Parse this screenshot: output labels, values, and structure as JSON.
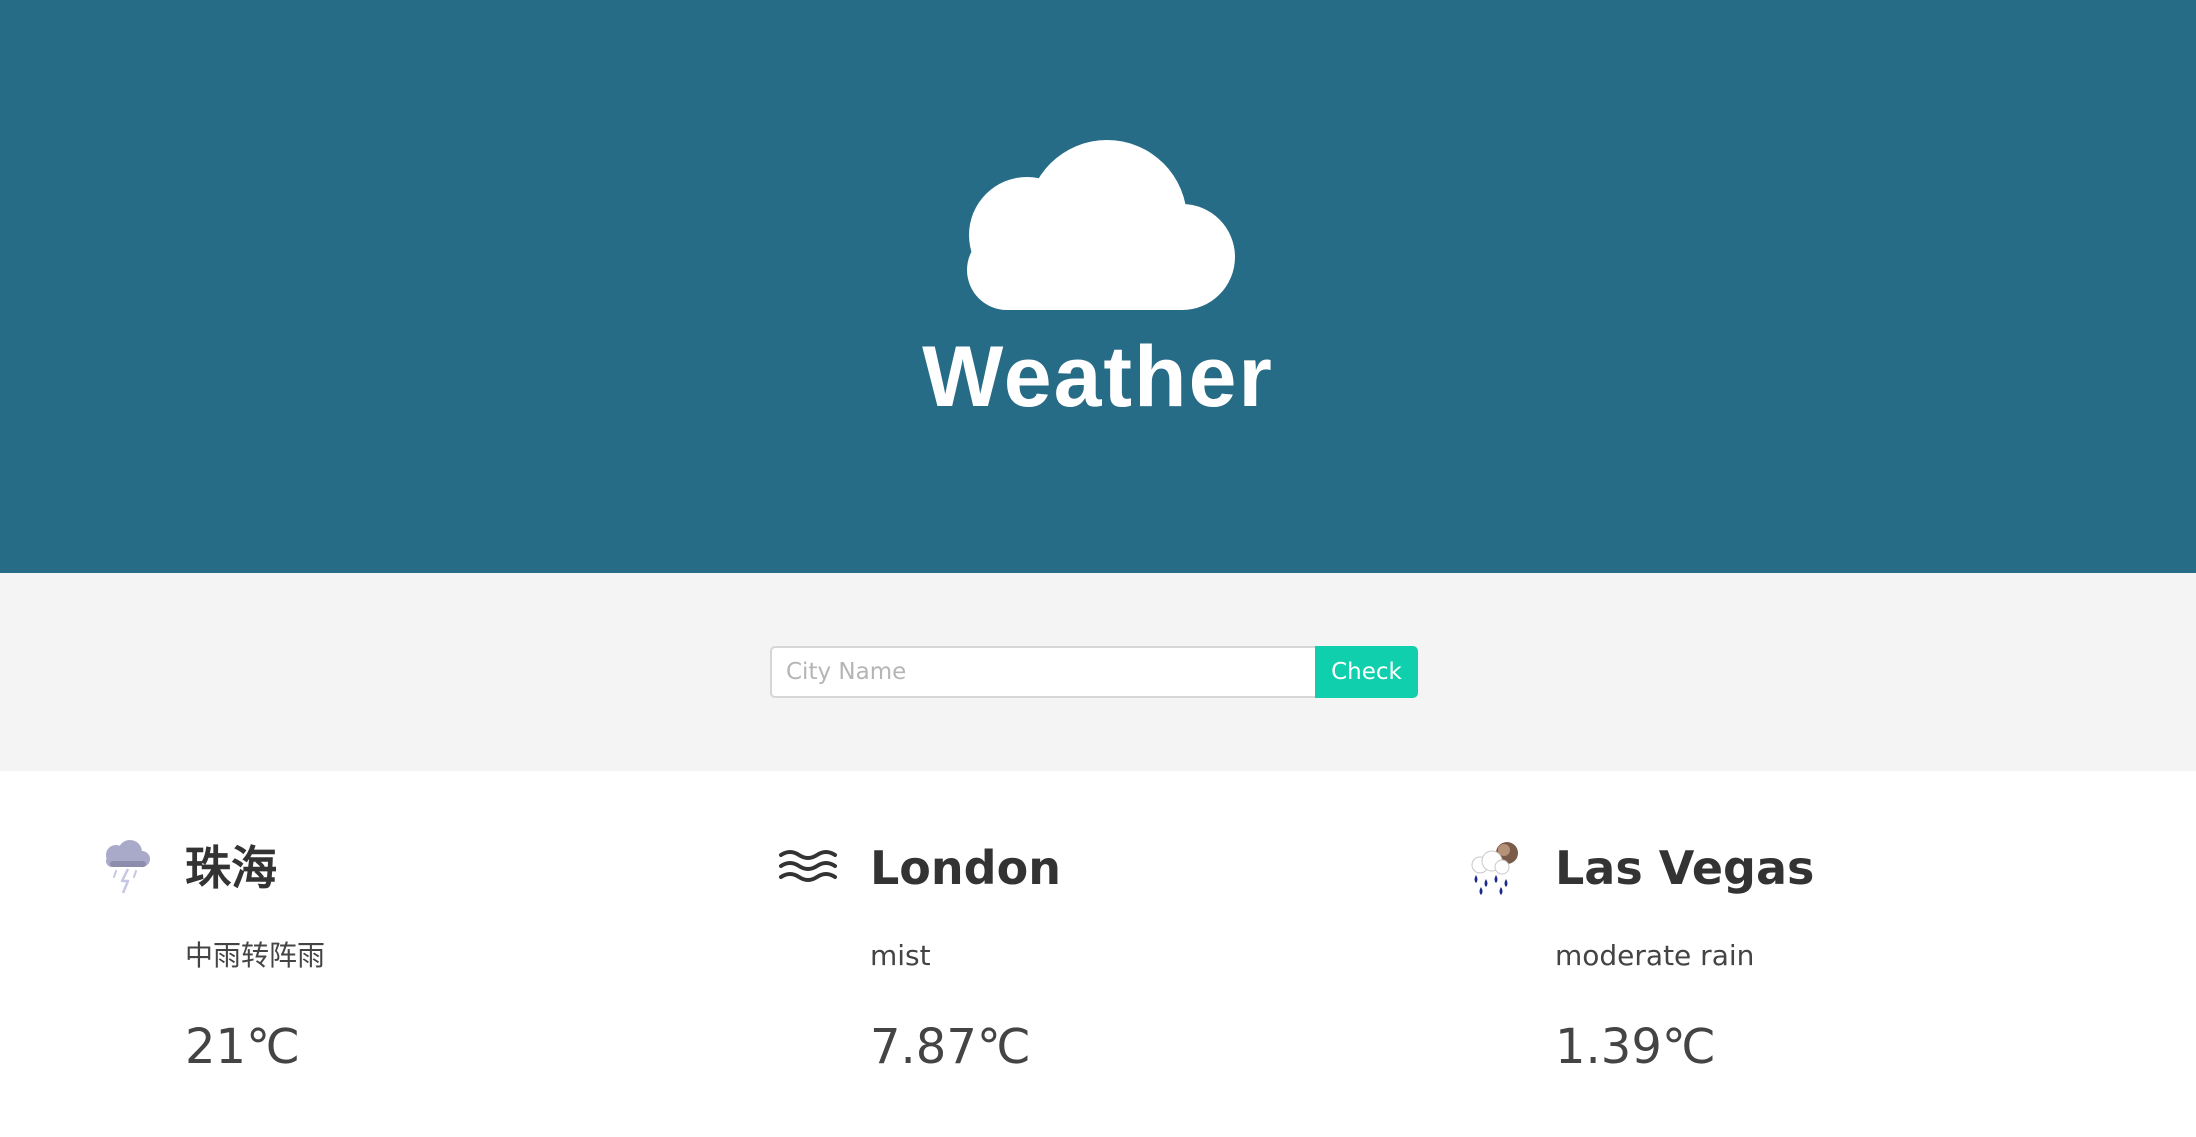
{
  "header": {
    "title": "Weather",
    "logo_icon": "cloud-icon",
    "background_color": "#276c86"
  },
  "search": {
    "placeholder": "City Name",
    "value": "",
    "button_label": "Check",
    "button_color": "#0fcfad"
  },
  "cities": [
    {
      "name": "珠海",
      "description": "中雨转阵雨",
      "temperature": "21℃",
      "icon": "thunderstorm-cloud-icon"
    },
    {
      "name": "London",
      "description": "mist",
      "temperature": "7.87℃",
      "icon": "mist-icon"
    },
    {
      "name": "Las Vegas",
      "description": "moderate rain",
      "temperature": "1.39℃",
      "icon": "rain-cloud-icon"
    }
  ]
}
